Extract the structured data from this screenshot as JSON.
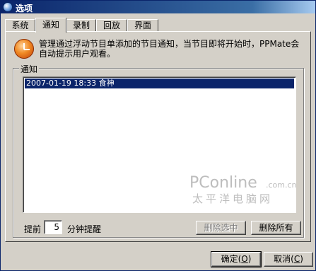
{
  "window": {
    "title": "选项"
  },
  "tabs": [
    {
      "label": "系统"
    },
    {
      "label": "通知",
      "active": true
    },
    {
      "label": "录制"
    },
    {
      "label": "回放"
    },
    {
      "label": "界面"
    }
  ],
  "notice_panel": {
    "description": "管理通过浮动节目单添加的节目通知，当节目即将开始时，PPMate会自动提示用户观看。",
    "group_label": "通知",
    "list_items": [
      "2007-01-19 18:33 食神"
    ],
    "advance_label": "提前",
    "advance_minutes": "5",
    "advance_unit": "分钟提醒",
    "remove_selected_label": "删除选中",
    "remove_all_label": "删除所有"
  },
  "watermark": {
    "main": "PConline",
    "sub": ".com.cn",
    "cn": "太平洋电脑网"
  },
  "footer": {
    "ok_label": "确定",
    "ok_key": "O",
    "cancel_label": "取消",
    "cancel_key": "C"
  },
  "icons": {
    "title_icon": "app-globe-icon",
    "info_icon": "alarm-clock-icon",
    "close_icon": "close-icon"
  },
  "colors": {
    "titlebar": "#0a246a",
    "selection": "#0a246a",
    "face": "#d4d0c8"
  }
}
